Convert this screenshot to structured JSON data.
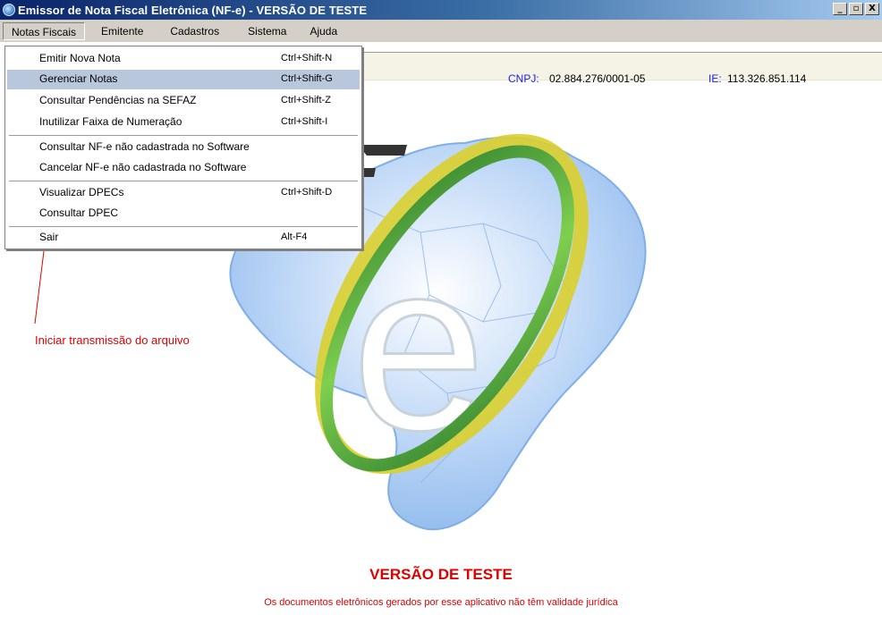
{
  "window": {
    "title": "Emissor de Nota Fiscal Eletrônica (NF-e) - VERSÃO DE TESTE",
    "buttons": [
      "_",
      "▫",
      "X"
    ]
  },
  "menubar": {
    "items": [
      "Notas Fiscais",
      "Emitente",
      "Cadastros",
      "Sistema",
      "Ajuda"
    ]
  },
  "info": {
    "cnpj_label": "CNPJ:",
    "cnpj_value": "02.884.276/0001-05",
    "ie_label": "IE:",
    "ie_value": "113.326.851.114"
  },
  "dropdown": {
    "items": [
      {
        "label": "Emitir Nova Nota",
        "shortcut": "Ctrl+Shift-N"
      },
      {
        "label": "Gerenciar Notas",
        "shortcut": "Ctrl+Shift-G"
      },
      {
        "label": "Consultar Pendências na SEFAZ",
        "shortcut": "Ctrl+Shift-Z"
      },
      {
        "label": "Inutilizar Faixa de Numeração",
        "shortcut": "Ctrl+Shift-I"
      },
      {
        "label": "Consultar NF-e não cadastrada no Software",
        "shortcut": ""
      },
      {
        "label": "Cancelar NF-e não cadastrada no Software",
        "shortcut": ""
      },
      {
        "label": "Visualizar DPECs",
        "shortcut": "Ctrl+Shift-D"
      },
      {
        "label": "Consultar DPEC",
        "shortcut": ""
      },
      {
        "label": "Sair",
        "shortcut": "Alt-F4"
      }
    ],
    "highlighted_index": 1
  },
  "annotation": {
    "text": "Iniciar transmissão do arquivo",
    "color": "#e00000"
  },
  "footer": {
    "title": "VERSÃO DE TESTE",
    "note": "Os documentos eletrônicos gerados por esse aplicativo não têm validade jurídica"
  },
  "colors": {
    "titlebar_start": "#0a246a",
    "menu_highlight": "#b9c7dd",
    "accent_red": "#e00000",
    "info_label_blue": "#1a1ae6",
    "logo_green": "#5aa83a",
    "logo_yellow": "#e0d53a",
    "map_blue": "#9cc2f0"
  }
}
